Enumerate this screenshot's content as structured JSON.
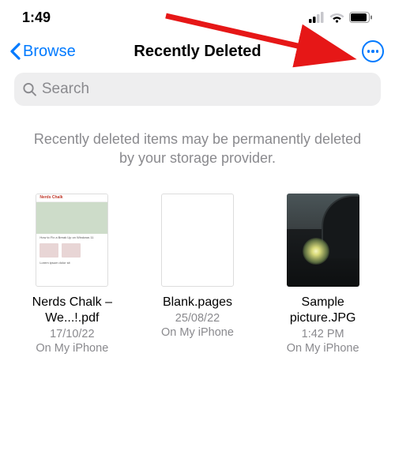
{
  "status": {
    "time": "1:49"
  },
  "nav": {
    "back_label": "Browse",
    "title": "Recently Deleted"
  },
  "search": {
    "placeholder": "Search"
  },
  "info": {
    "message": "Recently deleted items may be permanently deleted by your storage provider."
  },
  "files": [
    {
      "name": "Nerds Chalk – We...!.pdf",
      "date": "17/10/22",
      "location": "On My iPhone"
    },
    {
      "name": "Blank.pages",
      "date": "25/08/22",
      "location": "On My iPhone"
    },
    {
      "name": "Sample picture.JPG",
      "date": "1:42 PM",
      "location": "On My iPhone"
    }
  ],
  "colors": {
    "accent": "#007AFF",
    "muted": "#8a8a8e"
  }
}
